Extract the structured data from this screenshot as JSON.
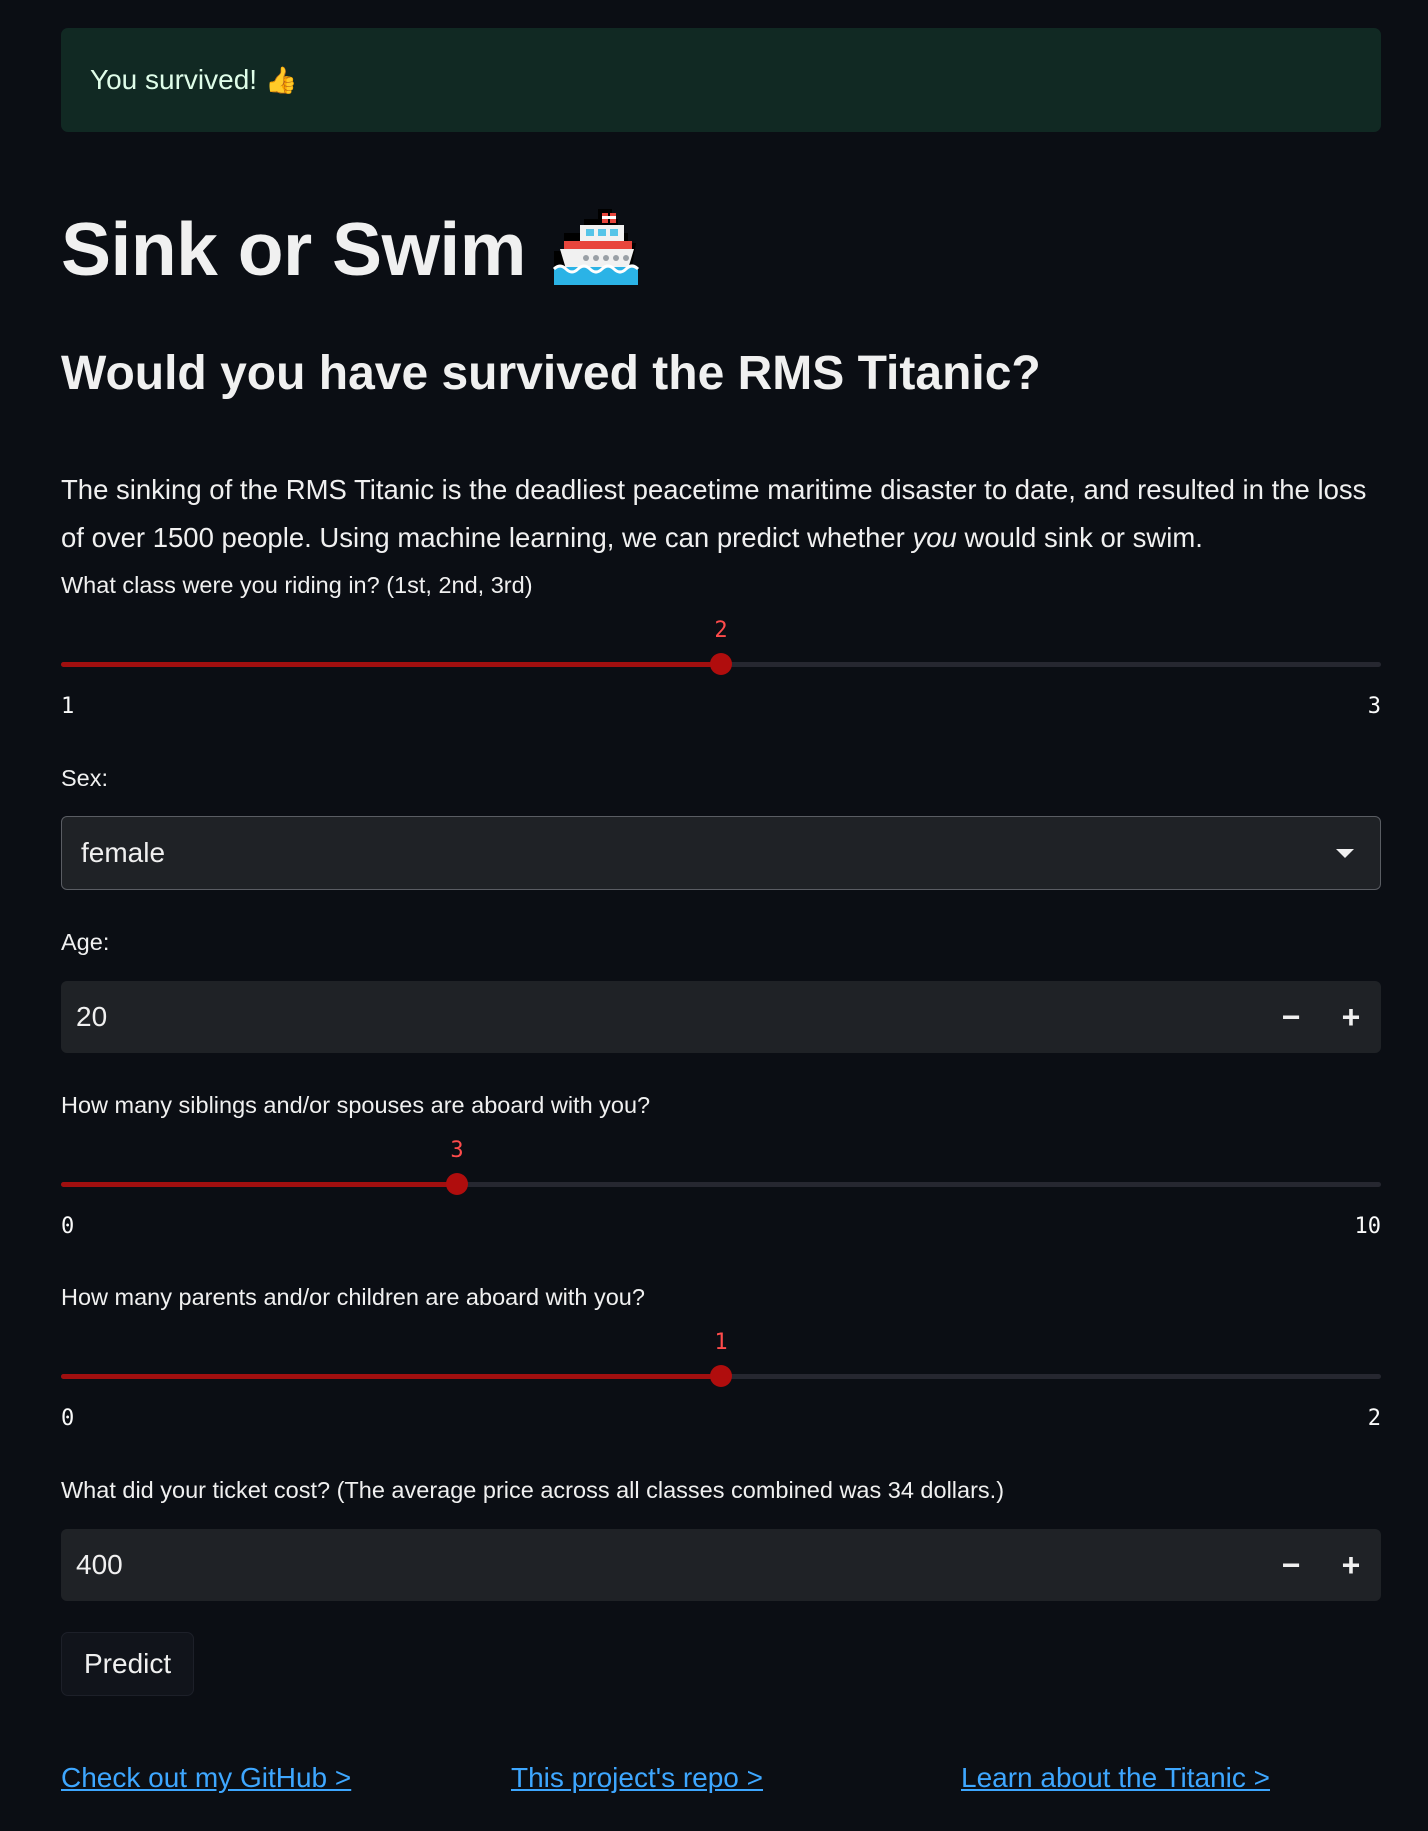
{
  "alert": {
    "text": "You survived!",
    "emoji": "👍"
  },
  "title": "Sink or Swim",
  "title_icon": "ship-icon",
  "subtitle": "Would you have survived the RMS Titanic?",
  "intro": {
    "part1": "The sinking of the RMS Titanic is the deadliest peacetime maritime disaster to date, and resulted in the loss of over 1500 people. Using machine learning, we can predict whether ",
    "emphasis": "you",
    "part2": " would sink or swim."
  },
  "class_slider": {
    "label": "What class were you riding in? (1st, 2nd, 3rd)",
    "value": "2",
    "min": "1",
    "max": "3"
  },
  "sex_select": {
    "label": "Sex:",
    "value": "female"
  },
  "age_input": {
    "label": "Age:",
    "value": "20",
    "minus": "−",
    "plus": "+"
  },
  "siblings_slider": {
    "label": "How many siblings and/or spouses are aboard with you?",
    "value": "3",
    "min": "0",
    "max": "10"
  },
  "parents_slider": {
    "label": "How many parents and/or children are aboard with you?",
    "value": "1",
    "min": "0",
    "max": "2"
  },
  "fare_input": {
    "label": "What did your ticket cost? (The average price across all classes combined was 34 dollars.)",
    "value": "400",
    "minus": "−",
    "plus": "+"
  },
  "predict_button": "Predict",
  "links": {
    "github": "Check out my GitHub >",
    "repo": "This project's repo >",
    "titanic": "Learn about the Titanic >"
  },
  "colors": {
    "accent": "#ff4b4b",
    "slider_fill": "#a10f0f",
    "link": "#3ea7ff",
    "success_bg": "#112923"
  }
}
